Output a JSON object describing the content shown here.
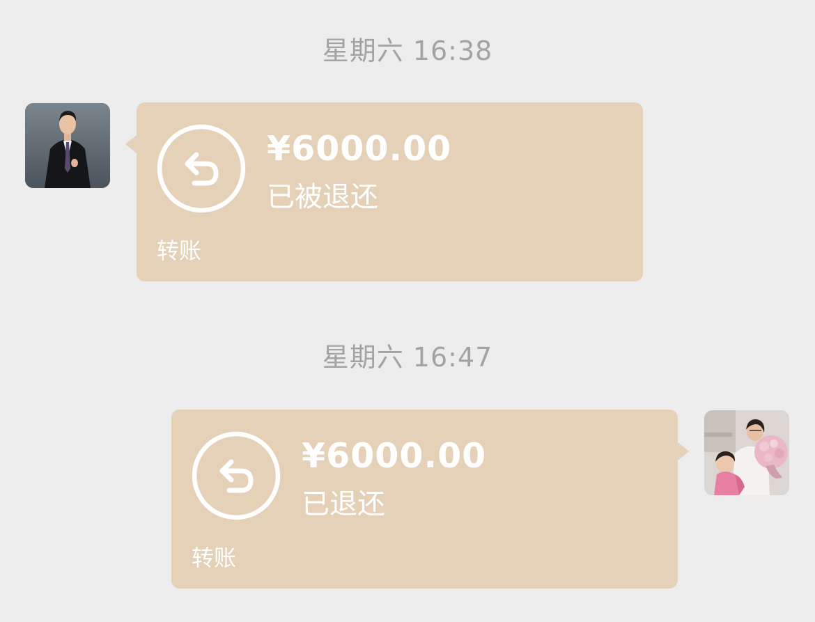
{
  "timestamps": [
    "星期六 16:38",
    "星期六 16:47"
  ],
  "messages": [
    {
      "side": "left",
      "amount": "¥6000.00",
      "status": "已被退还",
      "kind": "转账",
      "icon": "return-arrow-icon"
    },
    {
      "side": "right",
      "amount": "¥6000.00",
      "status": "已退还",
      "kind": "转账",
      "icon": "return-arrow-icon"
    }
  ],
  "colors": {
    "background": "#ededed",
    "bubble": "#e5d1b8",
    "text": "#ffffff",
    "timestamp": "#a3a3a3"
  }
}
